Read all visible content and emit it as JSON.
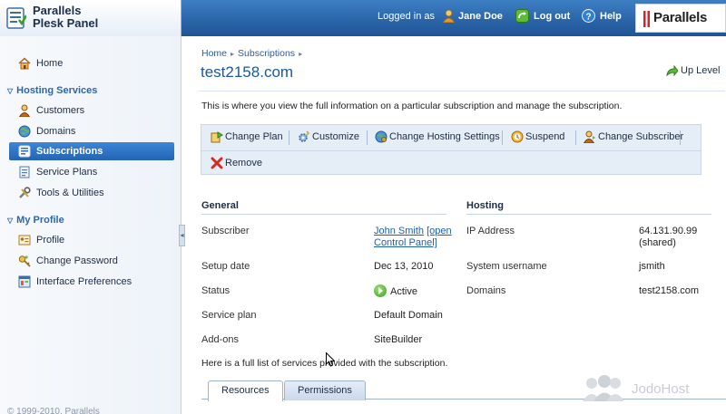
{
  "header": {
    "product_line1": "Parallels",
    "product_line2": "Plesk Panel",
    "logged_in_as": "Logged in as",
    "user_name": "Jane Doe",
    "logout": "Log out",
    "help": "Help",
    "brand": "Parallels"
  },
  "sidebar": {
    "home": "Home",
    "section_hosting": "Hosting Services",
    "items_hosting": [
      "Customers",
      "Domains",
      "Subscriptions",
      "Service Plans",
      "Tools & Utilities"
    ],
    "section_profile": "My Profile",
    "items_profile": [
      "Profile",
      "Change Password",
      "Interface Preferences"
    ],
    "copyright": "© 1999-2010, Parallels"
  },
  "main": {
    "breadcrumb": [
      "Home",
      "Subscriptions"
    ],
    "title": "test2158.com",
    "up_level": "Up Level",
    "description": "This is where you view the full information on a particular subscription and manage the subscription.",
    "toolbar": [
      "Change Plan",
      "Customize",
      "Change Hosting Settings",
      "Suspend",
      "Change Subscriber",
      "Remove"
    ],
    "general": {
      "heading": "General",
      "rows": [
        {
          "key": "Subscriber",
          "value": "John Smith",
          "link_extra": "[open Control Panel]"
        },
        {
          "key": "Setup date",
          "value": "Dec 13, 2010"
        },
        {
          "key": "Status",
          "value": "Active"
        },
        {
          "key": "Service plan",
          "value": "Default Domain"
        },
        {
          "key": "Add-ons",
          "value": "SiteBuilder"
        }
      ]
    },
    "hosting": {
      "heading": "Hosting",
      "rows": [
        {
          "key": "IP Address",
          "value": "64.131.90.99",
          "value2": "(shared)"
        },
        {
          "key": "System username",
          "value": "jsmith"
        },
        {
          "key": "Domains",
          "value": "test2158.com"
        }
      ]
    },
    "footnote": "Here is a full list of services provided with the subscription.",
    "tabs": [
      "Resources",
      "Permissions"
    ]
  },
  "watermark": "JodoHost",
  "colors": {
    "header_blue": "#2a65a8",
    "link_blue": "#1f5fb0",
    "active_nav": "#2d73c4",
    "toolbar_bg": "#e5edf6"
  }
}
